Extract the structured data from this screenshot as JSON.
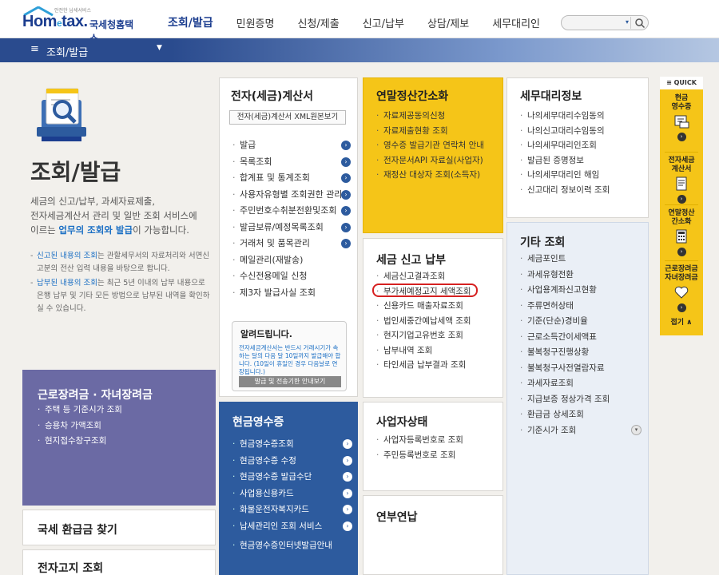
{
  "header": {
    "logo_tagline": "안전한 납세서비스",
    "logo_text": "Hom",
    "logo_e": "e",
    "logo_text2": "tax.",
    "logo_korean": "국세청홈택스",
    "nav": [
      "조회/발급",
      "민원증명",
      "신청/제출",
      "신고/납부",
      "상담/제보",
      "세무대리인"
    ],
    "search_placeholder": ""
  },
  "menu_bar": {
    "icon": "hamburger-icon",
    "label": "조회/발급"
  },
  "intro": {
    "title": "조회/발급",
    "desc_1": "세금의 신고/납부, 과세자료제출,",
    "desc_2": "전자세금계산서 관리 및 일반 조회 서비스에",
    "desc_3_pre": "이르는 ",
    "desc_3_hl": "업무의 조회와 발급",
    "desc_3_post": "이 가능합니다.",
    "note_1_pre": "신고된 내용의 조회",
    "note_1_post": "는 관할세무서의 자료처리와 서면신고분의 전산 입력 내용을 바탕으로 합니다.",
    "note_2_pre": "납부된 내용의 조회",
    "note_2_post": "는 최근 5년 이내의 납부 내용으로 은행 납부 및 기타 모든 방법으로 납부된 내역을 확인하실 수 있습니다."
  },
  "einvoice": {
    "title": "전자(세금)계산서",
    "xml_button": "전자(세금)계산서 XML원본보기",
    "items": [
      "발급",
      "목록조회",
      "합계표 및 통계조회",
      "사용자유형별 조회권한 관리",
      "주민번호수취분전환및조회",
      "발급보류/예정목록조회",
      "거래처 및 품목관리",
      "메일관리(재발송)",
      "수신전용메일 신청",
      "제3자 발급사실 조회"
    ]
  },
  "notice": {
    "title": "알려드립니다.",
    "body": "전자세금계산서는 반드시 거래시기가 속하는 달의 다음 달 10일까지 발급해야 합니다. (10일이 휴일인 경우 다음날로 연장됩니다.)",
    "button": "발급 및 전송기한 안내보기"
  },
  "year_end": {
    "title": "연말정산간소화",
    "items": [
      "자료제공동의신청",
      "자료제출현황 조회",
      "영수증 발급기관 연락처 안내",
      "전자문서API 자료실(사업자)",
      "재정산 대상자 조회(소득자)"
    ]
  },
  "tax_agent": {
    "title": "세무대리정보",
    "items": [
      "나의세무대리수임동의",
      "나의신고대리수임동의",
      "나의세무대리인조회",
      "발급된 증명정보",
      "나의세무대리인 해임",
      "신고대리 정보이력 조회"
    ]
  },
  "tax_report": {
    "title": "세금 신고 납부",
    "items": [
      "세금신고결과조회",
      "부가세예정고지 세액조회",
      "신용카드 매출자료조회",
      "법인세중간예납세액 조회",
      "현지기업고유번호 조회",
      "납부내역 조회",
      "타인세금 납부결과 조회"
    ]
  },
  "other": {
    "title": "기타 조회",
    "items": [
      "세금포인트",
      "과세유형전환",
      "사업용계좌신고현황",
      "주류면허상태",
      "기준(단순)경비율",
      "근로소득간이세액표",
      "불복청구진행상황",
      "불복청구사전열람자료",
      "과세자료조회",
      "지급보증 정상가격 조회",
      "환급금 상세조회",
      "기준시가 조회"
    ]
  },
  "cash_receipt": {
    "title": "현금영수증",
    "items": [
      "현금영수증조회",
      "현금영수증 수정",
      "현금영수증 발급수단",
      "사업용신용카드",
      "화물운전자복지카드",
      "납세관리인 조회 서비스",
      "현금영수증인터넷발급안내"
    ]
  },
  "business": {
    "title": "사업자상태",
    "items": [
      "사업자등록번호로 조회",
      "주민등록번호로 조회"
    ]
  },
  "annual": {
    "title": "연부연납"
  },
  "work_incentive": {
    "title": "근로장려금 · 자녀장려금",
    "items": [
      "주택 등 기준시가 조회",
      "승용차 가액조회",
      "현지접수창구조회"
    ]
  },
  "refund": {
    "title": "국세 환급금 찾기"
  },
  "bill": {
    "title": "전자고지 조회"
  },
  "quick": {
    "header": "≡ QUICK",
    "items": [
      {
        "l1": "현금",
        "l2": "영수증"
      },
      {
        "l1": "전자세금",
        "l2": "계산서"
      },
      {
        "l1": "연말정산",
        "l2": "간소화"
      },
      {
        "l1": "근로장려금",
        "l2": "자녀장려금"
      }
    ],
    "close": "접기 ∧"
  }
}
